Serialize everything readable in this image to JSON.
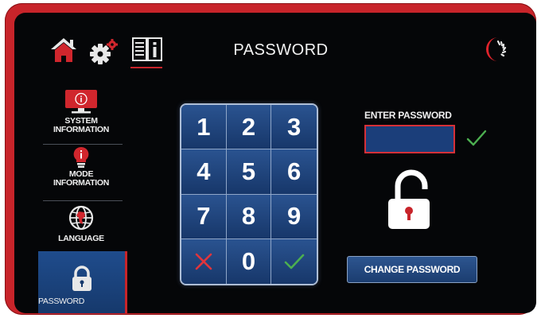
{
  "header": {
    "title": "PASSWORD",
    "icons": [
      "home-icon",
      "gear-icon",
      "info-icon",
      "brand-logo"
    ]
  },
  "sidebar": {
    "items": [
      {
        "label_line1": "SYSTEM",
        "label_line2": "INFORMATION",
        "icon": "monitor-info-icon"
      },
      {
        "label_line1": "MODE",
        "label_line2": "INFORMATION",
        "icon": "bulb-info-icon"
      },
      {
        "label_line1": "LANGUAGE",
        "label_line2": "",
        "icon": "globe-icon"
      },
      {
        "label_line1": "PASSWORD",
        "label_line2": "",
        "icon": "padlock-icon",
        "active": true
      }
    ]
  },
  "keypad": {
    "keys": [
      "1",
      "2",
      "3",
      "4",
      "5",
      "6",
      "7",
      "8",
      "9",
      "cancel",
      "0",
      "confirm"
    ]
  },
  "password": {
    "label": "ENTER PASSWORD",
    "value": "",
    "state": "unlocked"
  },
  "change_button": {
    "label": "CHANGE PASSWORD"
  },
  "colors": {
    "accent_red": "#c8242a",
    "panel_blue": "#1b3e7a",
    "confirm_green": "#4caf50"
  }
}
